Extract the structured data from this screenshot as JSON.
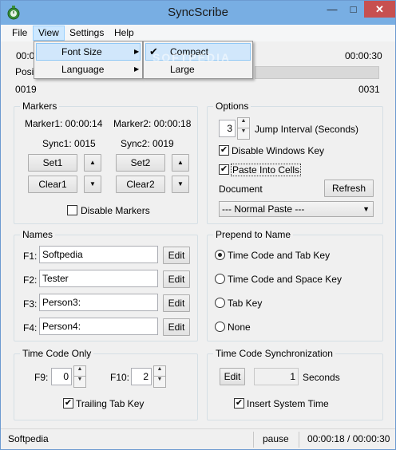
{
  "window": {
    "title": "SyncScribe"
  },
  "menubar": {
    "file": "File",
    "view": "View",
    "settings": "Settings",
    "help": "Help"
  },
  "view_menu": {
    "font_size": "Font Size",
    "language": "Language"
  },
  "font_size_submenu": {
    "compact": "Compact",
    "large": "Large",
    "selected": "Compact"
  },
  "timeline": {
    "start_time": "00:0",
    "end_time": "00:00:30",
    "position_label": "Posit",
    "marker_left": "0019",
    "marker_right": "0031"
  },
  "markers": {
    "title": "Markers",
    "marker1": "Marker1: 00:00:14",
    "marker2": "Marker2: 00:00:18",
    "sync1": "Sync1: 0015",
    "sync2": "Sync2: 0019",
    "set1": "Set1",
    "set2": "Set2",
    "clear1": "Clear1",
    "clear2": "Clear2",
    "disable_markers": "Disable Markers"
  },
  "options": {
    "title": "Options",
    "jump_interval_value": "3",
    "jump_interval_label": "Jump Interval (Seconds)",
    "disable_windows_key": "Disable Windows Key",
    "paste_into_cells": "Paste Into Cells",
    "document_label": "Document",
    "refresh": "Refresh",
    "paste_mode": "--- Normal Paste ---"
  },
  "names": {
    "title": "Names",
    "rows": [
      {
        "key": "F1:",
        "value": "Softpedia",
        "edit": "Edit"
      },
      {
        "key": "F2:",
        "value": "Tester",
        "edit": "Edit"
      },
      {
        "key": "F3:",
        "value": "Person3:",
        "edit": "Edit"
      },
      {
        "key": "F4:",
        "value": "Person4:",
        "edit": "Edit"
      }
    ]
  },
  "prepend": {
    "title": "Prepend to Name",
    "opt1": "Time Code and Tab Key",
    "opt2": "Time Code and Space Key",
    "opt3": "Tab Key",
    "opt4": "None",
    "selected": "Time Code and Tab Key"
  },
  "timecode_only": {
    "title": "Time Code Only",
    "f9_label": "F9:",
    "f9_value": "0",
    "f10_label": "F10:",
    "f10_value": "2",
    "trailing_tab": "Trailing Tab Key"
  },
  "tc_sync": {
    "title": "Time Code Synchronization",
    "edit": "Edit",
    "seconds_value": "1",
    "seconds_label": "Seconds",
    "insert_system_time": "Insert System Time"
  },
  "status": {
    "left": "Softpedia",
    "state": "pause",
    "time": "00:00:18 / 00:00:30"
  },
  "watermark": "SOFTPEDIA",
  "colors": {
    "titlebar": "#78aee3",
    "close": "#c75050",
    "highlight": "#d1e7fb"
  }
}
